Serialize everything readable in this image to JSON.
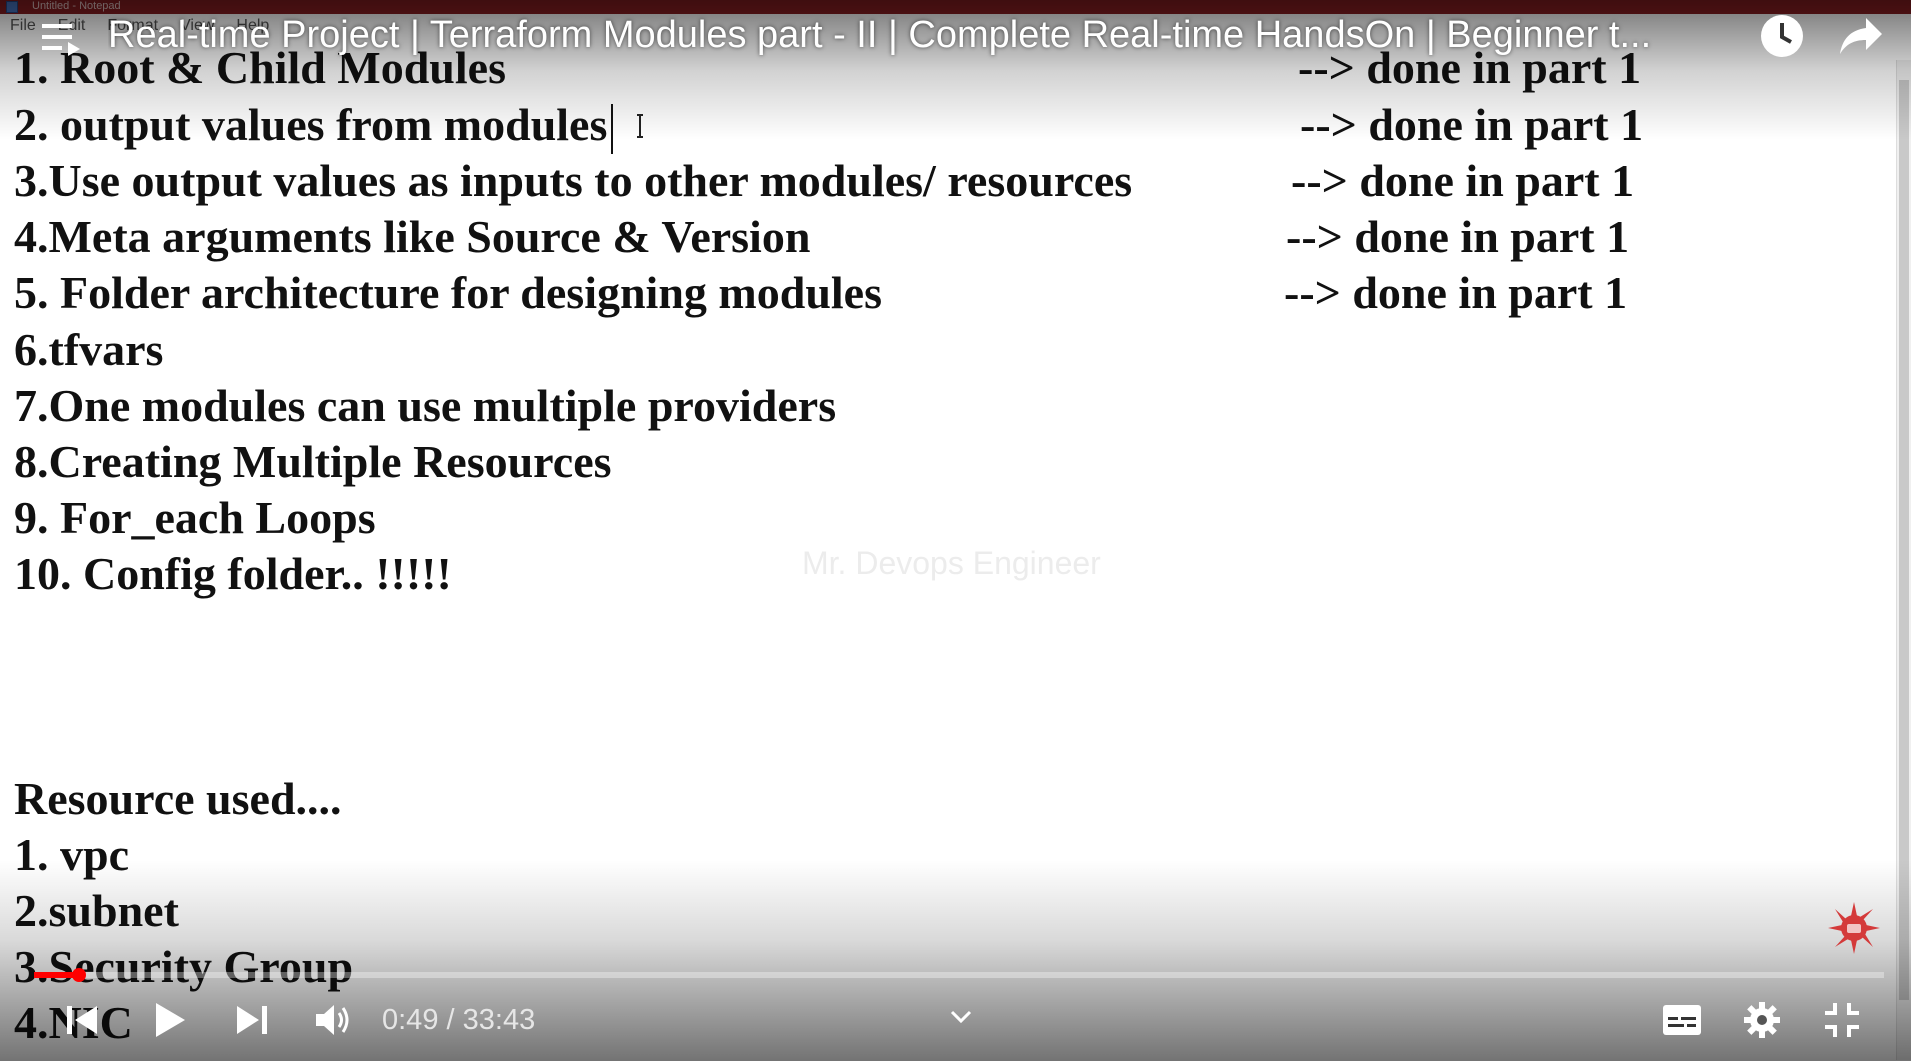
{
  "notepad": {
    "title": "Untitled - Notepad",
    "menu": [
      "File",
      "Edit",
      "Format",
      "View",
      "Help"
    ]
  },
  "document": {
    "lines": [
      "1. Root & Child Modules",
      "2. output values from modules",
      "3.Use output values as inputs to other modules/ resources",
      "4.Meta arguments like Source & Version",
      "5. Folder architecture for designing modules",
      "6.tfvars",
      "7.One modules can use multiple providers",
      "8.Creating Multiple Resources",
      "9. For_each Loops",
      "10. Config folder.. !!!!!"
    ],
    "done_notes": [
      "--> done in part 1",
      "--> done in part 1",
      "--> done in part 1",
      "--> done in part 1",
      "--> done in part 1"
    ],
    "resources_heading": "Resource used....",
    "resources": [
      "1. vpc",
      "2.subnet",
      "3.Security Group",
      "4.NIC"
    ],
    "watermark": "Mr. Devops Engineer"
  },
  "player": {
    "video_title": "Real-time Project | Terraform Modules part - II | Complete Real-time HandsOn | Beginner t...",
    "current_time": "0:49",
    "separator": " / ",
    "duration": "33:43",
    "progress_fraction": 0.0244,
    "accent_color": "#ff0000",
    "icons": {
      "menu": "playlist-menu-icon",
      "watch_later": "clock-icon",
      "share": "share-arrow-icon",
      "prev": "previous-icon",
      "play": "play-icon",
      "next": "next-icon",
      "volume": "volume-icon",
      "chevron": "chevron-down-icon",
      "captions": "captions-icon",
      "settings": "gear-icon",
      "exit_fullscreen": "exit-fullscreen-icon"
    }
  }
}
